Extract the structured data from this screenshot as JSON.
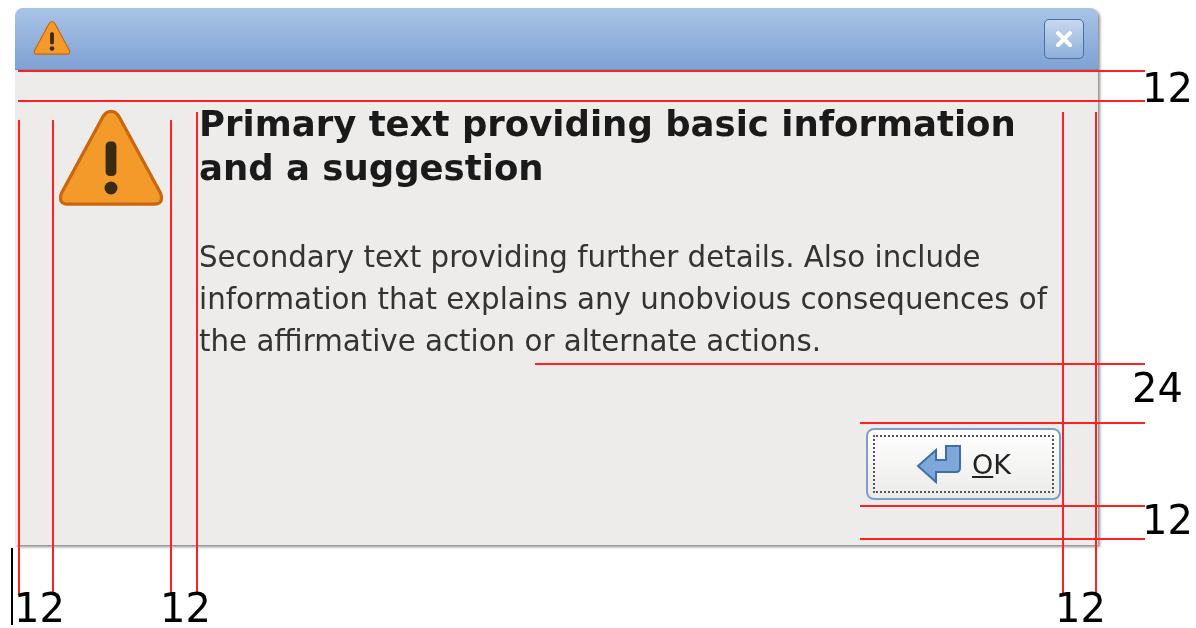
{
  "dialog": {
    "kind": "warning",
    "primary_text": "Primary text providing basic information and a suggestion",
    "secondary_text": "Secondary text providing further details. Also include information that explains any unobvious consequences of the affirmative action or alternate actions.",
    "buttons": [
      {
        "label_parts": [
          {
            "text": "O",
            "underlined": true
          },
          {
            "text": "K",
            "underlined": false
          }
        ],
        "focused": true
      }
    ]
  },
  "spacing_labels": [
    "12",
    "24",
    "12",
    "12",
    "12",
    "12"
  ]
}
